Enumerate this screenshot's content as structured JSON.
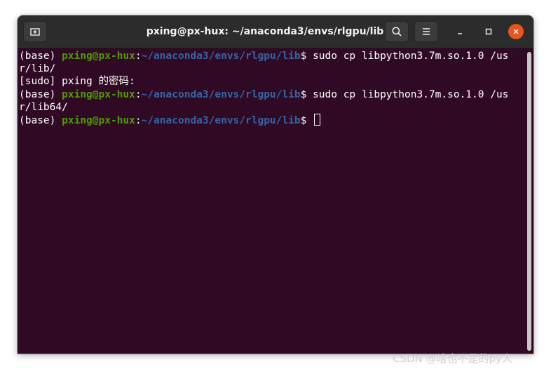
{
  "window": {
    "title": "pxing@px-hux: ~/anaconda3/envs/rlgpu/lib",
    "buttons": {
      "new_tab_icon": "new-tab-icon",
      "search_icon": "search-icon",
      "menu_icon": "hamburger-menu-icon",
      "minimize_icon": "minimize-icon",
      "maximize_icon": "maximize-icon",
      "close_icon": "close-icon"
    }
  },
  "colors": {
    "terminal_bg": "#300a24",
    "titlebar_bg": "#2c2c2c",
    "user_host": "#4e9a06",
    "path": "#3465a4",
    "close_button": "#e95420"
  },
  "terminal": {
    "lines": [
      {
        "env": "(base) ",
        "user_host": "pxing@px-hux",
        "sep": ":",
        "path": "~/anaconda3/envs/rlgpu/lib",
        "command": "$ sudo cp libpython3.7m.so.1.0 /us"
      },
      {
        "text": "r/lib/"
      },
      {
        "text": "[sudo] pxing 的密码:"
      },
      {
        "env": "(base) ",
        "user_host": "pxing@px-hux",
        "sep": ":",
        "path": "~/anaconda3/envs/rlgpu/lib",
        "command": "$ sudo cp libpython3.7m.so.1.0 /us"
      },
      {
        "text": "r/lib64/"
      },
      {
        "env": "(base) ",
        "user_host": "pxing@px-hux",
        "sep": ":",
        "path": "~/anaconda3/envs/rlgpu/lib",
        "command": "$ "
      }
    ]
  },
  "watermark": "CSDN @啥也不是的py人"
}
